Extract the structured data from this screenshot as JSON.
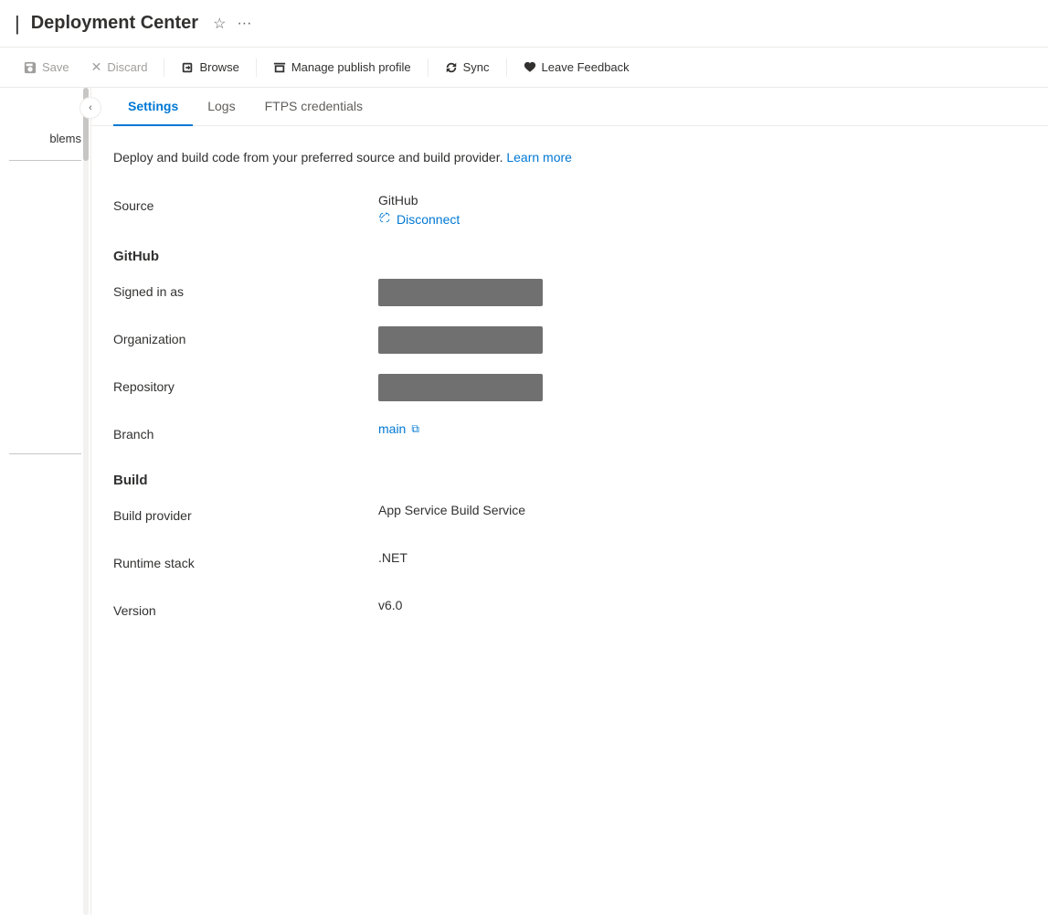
{
  "header": {
    "pipe": "|",
    "title": "Deployment Center",
    "star_label": "☆",
    "ellipsis_label": "···"
  },
  "toolbar": {
    "save_label": "Save",
    "discard_label": "Discard",
    "browse_label": "Browse",
    "manage_publish_label": "Manage publish profile",
    "sync_label": "Sync",
    "leave_feedback_label": "Leave Feedback"
  },
  "sidebar": {
    "collapse_icon": "‹",
    "problems_label": "blems"
  },
  "tabs": [
    {
      "id": "settings",
      "label": "Settings",
      "active": true
    },
    {
      "id": "logs",
      "label": "Logs",
      "active": false
    },
    {
      "id": "ftps",
      "label": "FTPS credentials",
      "active": false
    }
  ],
  "content": {
    "description": "Deploy and build code from your preferred source and build provider.",
    "learn_more_label": "Learn more",
    "source_section": {
      "label": "Source",
      "value": "GitHub",
      "disconnect_label": "Disconnect",
      "disconnect_icon": "🔗"
    },
    "github_section": {
      "title": "GitHub",
      "signed_in_as_label": "Signed in as",
      "organization_label": "Organization",
      "repository_label": "Repository",
      "branch_label": "Branch",
      "branch_value": "main",
      "external_link_icon": "⧉"
    },
    "build_section": {
      "title": "Build",
      "build_provider_label": "Build provider",
      "build_provider_value": "App Service Build Service",
      "runtime_stack_label": "Runtime stack",
      "runtime_stack_value": ".NET",
      "version_label": "Version",
      "version_value": "v6.0"
    }
  }
}
